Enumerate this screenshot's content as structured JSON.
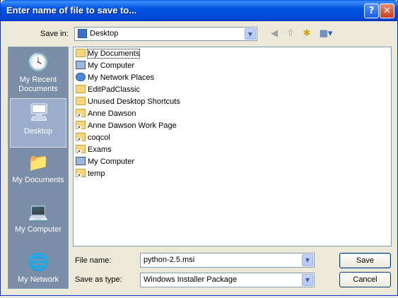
{
  "window": {
    "title": "Enter name of file to save to..."
  },
  "titlebar_buttons": {
    "help": "?",
    "close": "✕"
  },
  "save_in": {
    "label": "Save in:",
    "value": "Desktop"
  },
  "toolbar": {
    "icons": [
      "back-icon",
      "up-folder-icon",
      "new-folder-icon",
      "views-menu-icon"
    ]
  },
  "places": [
    {
      "label": "My Recent Documents",
      "icon": "recent-documents-icon",
      "selected": false
    },
    {
      "label": "Desktop",
      "icon": "desktop-icon",
      "selected": true
    },
    {
      "label": "My Documents",
      "icon": "my-documents-icon",
      "selected": false
    },
    {
      "label": "My Computer",
      "icon": "my-computer-icon",
      "selected": false
    },
    {
      "label": "My Network",
      "icon": "my-network-icon",
      "selected": false
    }
  ],
  "files": [
    {
      "name": "My Documents",
      "icon": "folder-icon"
    },
    {
      "name": "My Computer",
      "icon": "computer-icon"
    },
    {
      "name": "My Network Places",
      "icon": "network-places-icon"
    },
    {
      "name": "EditPadClassic",
      "icon": "folder-icon"
    },
    {
      "name": "Unused Desktop Shortcuts",
      "icon": "folder-icon"
    },
    {
      "name": "Anne Dawson",
      "icon": "folder-shortcut-icon"
    },
    {
      "name": "Anne Dawson Work Page",
      "icon": "folder-shortcut-icon"
    },
    {
      "name": "coqcol",
      "icon": "folder-shortcut-icon"
    },
    {
      "name": "Exams",
      "icon": "folder-shortcut-icon"
    },
    {
      "name": "My Computer",
      "icon": "computer-shortcut-icon"
    },
    {
      "name": "temp",
      "icon": "folder-shortcut-icon"
    }
  ],
  "file_name": {
    "label": "File name:",
    "value": "python-2.5.msi"
  },
  "save_as_type": {
    "label": "Save as type:",
    "value": "Windows Installer Package"
  },
  "buttons": {
    "save": "Save",
    "cancel": "Cancel"
  }
}
